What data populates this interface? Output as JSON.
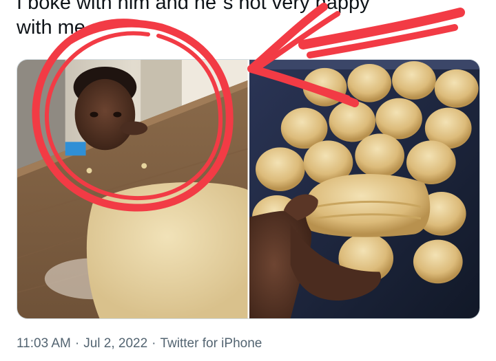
{
  "tweet": {
    "text_line_1": "I boke with him and he´s not very happy",
    "text_line_2": "with me"
  },
  "media": {
    "photos": [
      {
        "name": "toddler-and-dough-photo"
      },
      {
        "name": "biscuits-tray-photo"
      }
    ]
  },
  "annotations": {
    "circle_color": "#f23b45",
    "arrow_color": "#f23b45"
  },
  "meta": {
    "time": "11:03 AM",
    "separator": "·",
    "date": "Jul 2, 2022",
    "source": "Twitter for iPhone"
  }
}
